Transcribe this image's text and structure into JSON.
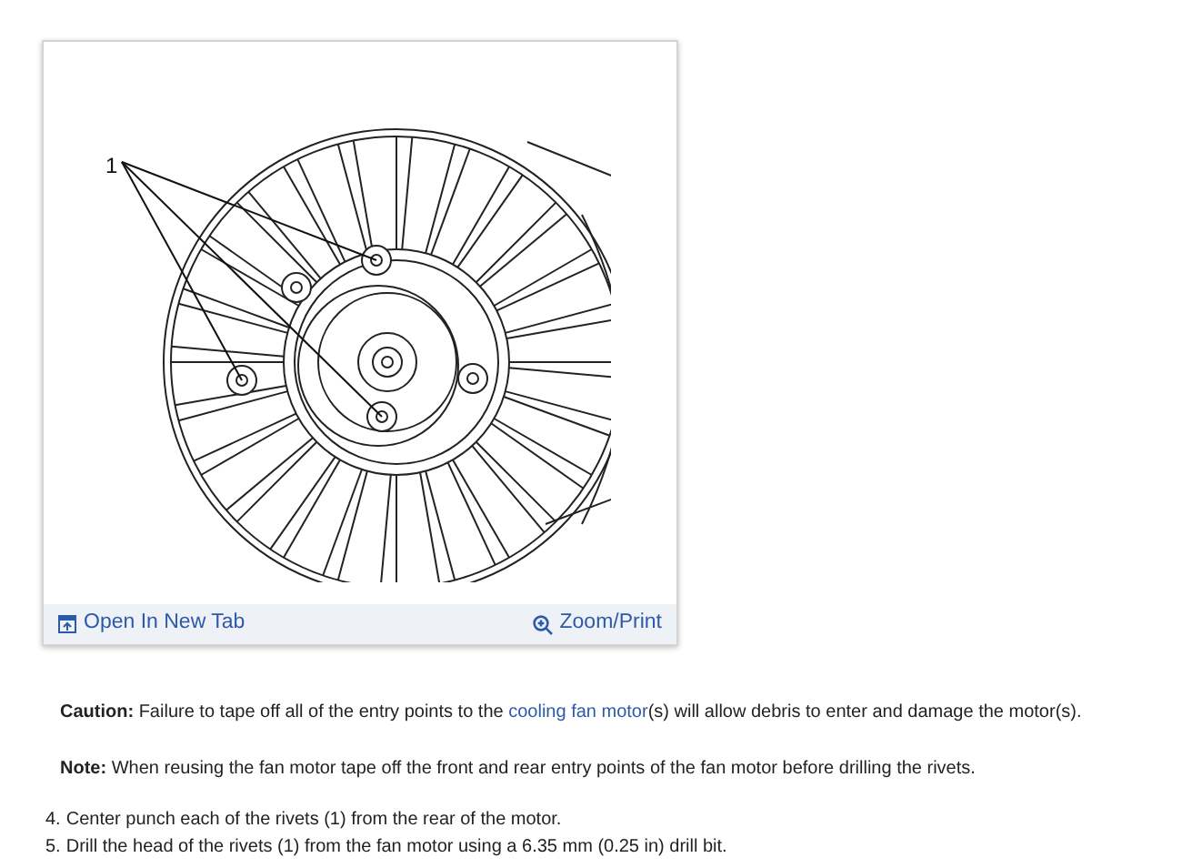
{
  "figure": {
    "callout": "1",
    "open_link": "Open In New Tab",
    "zoom_link": "Zoom/Print"
  },
  "caution": {
    "before": "**Caution:** Failure to tape off all of the entry points to the ",
    "link": "cooling fan motor",
    "after": "(s) will allow debris to enter and damage the motor(s)."
  },
  "note": {
    "text": "**Note:** When reusing the fan motor tape off the front and rear entry points of the fan motor before drilling the rivets."
  },
  "steps": [
    {
      "number": "4.",
      "text": "Center punch each of the rivets (1) from the rear of the motor."
    },
    {
      "number": "5.",
      "text": "Drill the head of the rivets (1) from the fan motor using a 6.35 mm (0.25 in) drill bit."
    }
  ]
}
